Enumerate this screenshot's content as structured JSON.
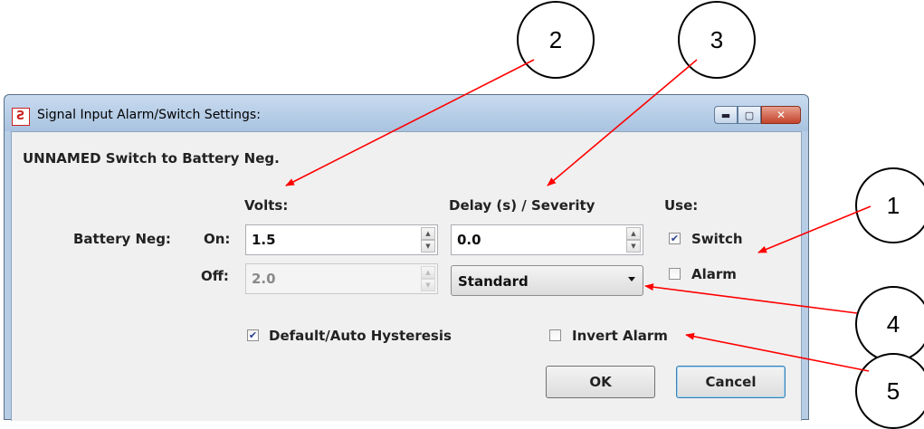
{
  "window": {
    "title": "Signal Input Alarm/Switch Settings:",
    "controls": {
      "minimize": "▬",
      "maximize": "▢",
      "close": "✕"
    }
  },
  "dialog": {
    "heading": "UNNAMED Switch to Battery Neg.",
    "columns": {
      "volts": "Volts:",
      "delay": "Delay (s) / Severity",
      "use": "Use:"
    },
    "row_label": "Battery Neg:",
    "on_label": "On:",
    "off_label": "Off:",
    "on_volts": "1.5",
    "off_volts": "2.0",
    "on_delay": "0.0",
    "severity": "Standard",
    "switch": {
      "label": "Switch",
      "checked": true
    },
    "alarm": {
      "label": "Alarm",
      "checked": false
    },
    "hysteresis": {
      "label": "Default/Auto Hysteresis",
      "checked": true
    },
    "invert": {
      "label": "Invert Alarm",
      "checked": false
    },
    "ok_label": "OK",
    "cancel_label": "Cancel"
  },
  "callouts": [
    "1",
    "2",
    "3",
    "4",
    "5"
  ],
  "colors": {
    "arrow": "#ff0000",
    "titlebar": "#b9d1ea",
    "dialog_bg": "#f0f0f0"
  }
}
